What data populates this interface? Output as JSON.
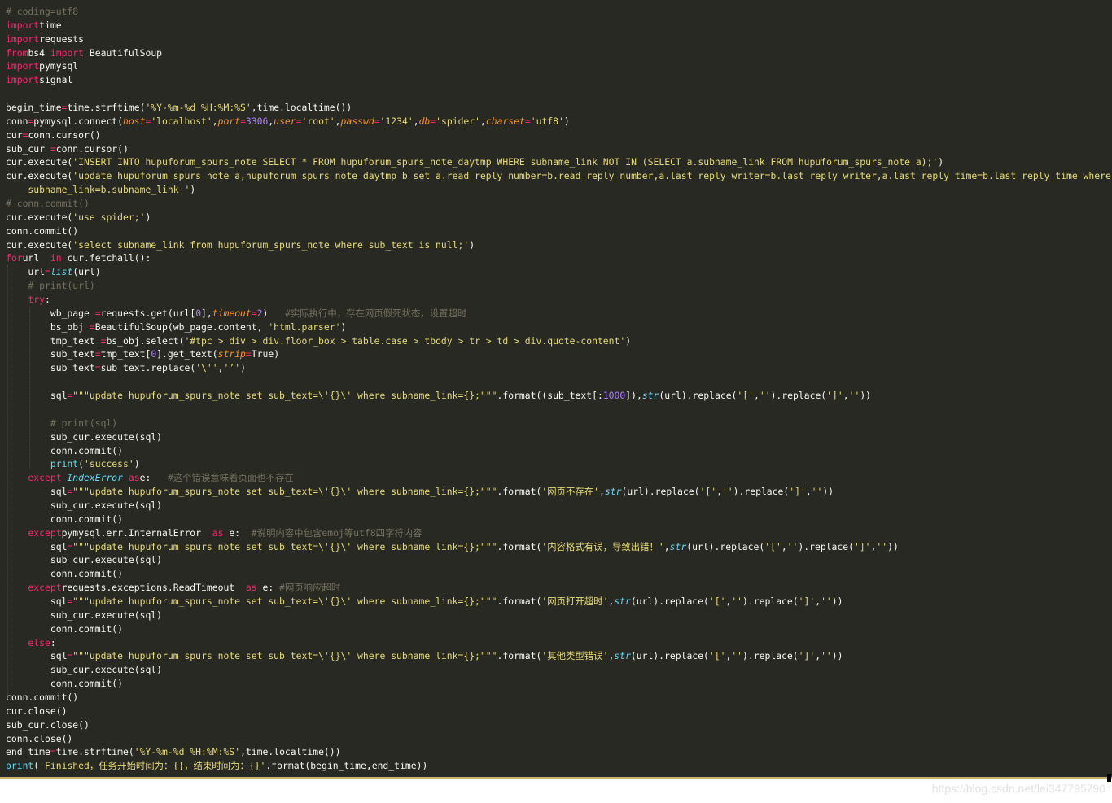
{
  "editor": {
    "theme_colors": {
      "background": "#282923",
      "text": "#f8f8f2",
      "keyword": "#f92672",
      "string": "#e6db74",
      "number": "#ae81ff",
      "comment": "#75715e",
      "parameter": "#fd971f",
      "builtin": "#66d9ef"
    },
    "lines": [
      [
        [
          "cm",
          "# coding=utf8"
        ]
      ],
      [
        [
          "kw",
          "import"
        ],
        [
          "",
          "time"
        ]
      ],
      [
        [
          "kw",
          "import"
        ],
        [
          "",
          "requests"
        ]
      ],
      [
        [
          "kw",
          "from"
        ],
        [
          "",
          "bs4"
        ],
        [
          "kw",
          "import"
        ],
        [
          "",
          "BeautifulSoup"
        ]
      ],
      [
        [
          "kw",
          "import"
        ],
        [
          "",
          "pymysql"
        ]
      ],
      [
        [
          "kw",
          "import"
        ],
        [
          "",
          "signal"
        ]
      ],
      [],
      [
        [
          "",
          "begin_time"
        ],
        [
          "kw",
          "="
        ],
        [
          "",
          "time.strftime("
        ],
        [
          "str",
          "'%Y-%m-%d %H:%M:%S'"
        ],
        [
          "",
          ",time.localtime())"
        ]
      ],
      [
        [
          "",
          "conn"
        ],
        [
          "kw",
          "="
        ],
        [
          "",
          "pymysql.connect("
        ],
        [
          "param",
          "host"
        ],
        [
          "kw",
          "="
        ],
        [
          "str",
          "'localhost'"
        ],
        [
          "",
          ","
        ],
        [
          "param",
          "port"
        ],
        [
          "kw",
          "="
        ],
        [
          "num",
          "3306"
        ],
        [
          "",
          ","
        ],
        [
          "param",
          "user"
        ],
        [
          "kw",
          "="
        ],
        [
          "str",
          "'root'"
        ],
        [
          "",
          ","
        ],
        [
          "param",
          "passwd"
        ],
        [
          "kw",
          "="
        ],
        [
          "str",
          "'1234'"
        ],
        [
          "",
          ","
        ],
        [
          "param",
          "db"
        ],
        [
          "kw",
          "="
        ],
        [
          "str",
          "'spider'"
        ],
        [
          "",
          ","
        ],
        [
          "param",
          "charset"
        ],
        [
          "kw",
          "="
        ],
        [
          "str",
          "'utf8'"
        ],
        [
          "",
          ")"
        ]
      ],
      [
        [
          "",
          "cur"
        ],
        [
          "kw",
          "="
        ],
        [
          "",
          "conn.cursor()"
        ]
      ],
      [
        [
          "",
          "sub_cur "
        ],
        [
          "kw",
          "="
        ],
        [
          "",
          ""
        ],
        [
          "",
          "conn.cursor()"
        ]
      ],
      [
        [
          "",
          "cur.execute("
        ],
        [
          "str",
          "'INSERT INTO hupuforum_spurs_note SELECT * FROM hupuforum_spurs_note_daytmp WHERE subname_link NOT IN (SELECT a.subname_link FROM hupuforum_spurs_note a);'"
        ],
        [
          "",
          ")"
        ]
      ],
      [
        [
          "",
          "cur.execute("
        ],
        [
          "str",
          "'update hupuforum_spurs_note a,hupuforum_spurs_note_daytmp b set a.read_reply_number=b.read_reply_number,a.last_reply_writer=b.last_reply_writer,a.last_reply_time=b.last_reply_time where a."
        ]
      ],
      [
        [
          "str",
          "    subname_link=b.subname_link '"
        ],
        [
          "",
          ")"
        ]
      ],
      [
        [
          "cm",
          "# conn.commit()"
        ]
      ],
      [
        [
          "",
          "cur.execute("
        ],
        [
          "str",
          "'use spider;'"
        ],
        [
          "",
          ")"
        ]
      ],
      [
        [
          "",
          "conn.commit()"
        ]
      ],
      [
        [
          "",
          "cur.execute("
        ],
        [
          "str",
          "'select subname_link from hupuforum_spurs_note where sub_text is null;'"
        ],
        [
          "",
          ")"
        ]
      ],
      [
        [
          "kw",
          "for"
        ],
        [
          "",
          "url "
        ],
        [
          "kw",
          "in"
        ],
        [
          "",
          "cur.fetchall():"
        ]
      ],
      [
        [
          "",
          "    url"
        ],
        [
          "kw",
          "="
        ],
        [
          "bi",
          "list"
        ],
        [
          "",
          "(url)"
        ]
      ],
      [
        [
          "cm",
          "    # print(url)"
        ]
      ],
      [
        [
          "kw",
          "    try"
        ],
        [
          "",
          ":"
        ]
      ],
      [
        [
          "",
          "        wb_page "
        ],
        [
          "kw",
          "="
        ],
        [
          "",
          "requests.get(url["
        ],
        [
          "num",
          "0"
        ],
        [
          "",
          "],"
        ],
        [
          "param",
          "timeout"
        ],
        [
          "kw",
          "="
        ],
        [
          "num",
          "2"
        ],
        [
          "",
          ")   "
        ],
        [
          "cm",
          "#实际执行中，存在网页假死状态，设置超时"
        ]
      ],
      [
        [
          "",
          "        bs_obj "
        ],
        [
          "kw",
          "="
        ],
        [
          "",
          "BeautifulSoup(wb_page.content, "
        ],
        [
          "str",
          "'html.parser'"
        ],
        [
          "",
          ")"
        ]
      ],
      [
        [
          "",
          "        tmp_text "
        ],
        [
          "kw",
          "="
        ],
        [
          "",
          "bs_obj.select("
        ],
        [
          "str",
          "'#tpc > div > div.floor_box > table.case > tbody > tr > td > div.quote-content'"
        ],
        [
          "",
          ")"
        ]
      ],
      [
        [
          "",
          "        sub_text"
        ],
        [
          "kw",
          "="
        ],
        [
          "",
          "tmp_text["
        ],
        [
          "num",
          "0"
        ],
        [
          "",
          "].get_text("
        ],
        [
          "param",
          "strip"
        ],
        [
          "kw",
          "="
        ],
        [
          "",
          "True)"
        ]
      ],
      [
        [
          "",
          "        sub_text"
        ],
        [
          "kw",
          "="
        ],
        [
          "",
          "sub_text.replace("
        ],
        [
          "str",
          "'\\''"
        ],
        [
          "",
          ","
        ],
        [
          "str",
          "'’'"
        ],
        [
          "",
          ")"
        ]
      ],
      [],
      [
        [
          "",
          "        sql"
        ],
        [
          "kw",
          "="
        ],
        [
          "str",
          "\"\"\"update hupuforum_spurs_note set sub_text=\\'{}\\' where subname_link={};\"\"\""
        ],
        [
          "",
          ".format((sub_text[:"
        ],
        [
          "num",
          "1000"
        ],
        [
          "",
          "]),"
        ],
        [
          "bi",
          "str"
        ],
        [
          "",
          "(url).replace("
        ],
        [
          "str",
          "'['"
        ],
        [
          "",
          ","
        ],
        [
          "str",
          "''"
        ],
        [
          "",
          ").replace("
        ],
        [
          "str",
          "']'"
        ],
        [
          "",
          ","
        ],
        [
          "str",
          "''"
        ],
        [
          "",
          "))"
        ]
      ],
      [],
      [
        [
          "cm",
          "        # print(sql)"
        ]
      ],
      [
        [
          "",
          "        sub_cur.execute(sql)"
        ]
      ],
      [
        [
          "",
          "        conn.commit()"
        ]
      ],
      [
        [
          "fn",
          "        print"
        ],
        [
          "",
          "("
        ],
        [
          "str",
          "'success'"
        ],
        [
          "",
          ")"
        ]
      ],
      [
        [
          "kw",
          "    except"
        ],
        [
          "",
          ""
        ],
        [
          "bi",
          " IndexError"
        ],
        [
          "kw",
          " as"
        ],
        [
          "",
          "e:   "
        ],
        [
          "cm",
          "#这个错误意味着页面也不存在"
        ]
      ],
      [
        [
          "",
          "        sql"
        ],
        [
          "kw",
          "="
        ],
        [
          "str",
          "\"\"\"update hupuforum_spurs_note set sub_text=\\'{}\\' where subname_link={};\"\"\""
        ],
        [
          "",
          ".format("
        ],
        [
          "str",
          "'网页不存在'"
        ],
        [
          "",
          ","
        ],
        [
          "bi",
          "str"
        ],
        [
          "",
          "(url).replace("
        ],
        [
          "str",
          "'['"
        ],
        [
          "",
          ","
        ],
        [
          "str",
          "''"
        ],
        [
          "",
          ").replace("
        ],
        [
          "str",
          "']'"
        ],
        [
          "",
          ","
        ],
        [
          "str",
          "''"
        ],
        [
          "",
          "))"
        ]
      ],
      [
        [
          "",
          "        sub_cur.execute(sql)"
        ]
      ],
      [
        [
          "",
          "        conn.commit()"
        ]
      ],
      [
        [
          "kw",
          "    except"
        ],
        [
          "",
          "pymysql.err.InternalError "
        ],
        [
          "kw",
          "as"
        ],
        [
          "",
          "e:  "
        ],
        [
          "cm",
          "#说明内容中包含emoj等utf8四字符内容"
        ]
      ],
      [
        [
          "",
          "        sql"
        ],
        [
          "kw",
          "="
        ],
        [
          "str",
          "\"\"\"update hupuforum_spurs_note set sub_text=\\'{}\\' where subname_link={};\"\"\""
        ],
        [
          "",
          ".format("
        ],
        [
          "str",
          "'内容格式有误，导致出错！'"
        ],
        [
          "",
          ","
        ],
        [
          "bi",
          "str"
        ],
        [
          "",
          "(url).replace("
        ],
        [
          "str",
          "'['"
        ],
        [
          "",
          ","
        ],
        [
          "str",
          "''"
        ],
        [
          "",
          ").replace("
        ],
        [
          "str",
          "']'"
        ],
        [
          "",
          ","
        ],
        [
          "str",
          "''"
        ],
        [
          "",
          "))"
        ]
      ],
      [
        [
          "",
          "        sub_cur.execute(sql)"
        ]
      ],
      [
        [
          "",
          "        conn.commit()"
        ]
      ],
      [
        [
          "kw",
          "    except"
        ],
        [
          "",
          "requests.exceptions.ReadTimeout "
        ],
        [
          "kw",
          "as"
        ],
        [
          "",
          "e: "
        ],
        [
          "cm",
          "#网页响应超时"
        ]
      ],
      [
        [
          "",
          "        sql"
        ],
        [
          "kw",
          "="
        ],
        [
          "str",
          "\"\"\"update hupuforum_spurs_note set sub_text=\\'{}\\' where subname_link={};\"\"\""
        ],
        [
          "",
          ".format("
        ],
        [
          "str",
          "'网页打开超时'"
        ],
        [
          "",
          ","
        ],
        [
          "bi",
          "str"
        ],
        [
          "",
          "(url).replace("
        ],
        [
          "str",
          "'['"
        ],
        [
          "",
          ","
        ],
        [
          "str",
          "''"
        ],
        [
          "",
          ").replace("
        ],
        [
          "str",
          "']'"
        ],
        [
          "",
          ","
        ],
        [
          "str",
          "''"
        ],
        [
          "",
          "))"
        ]
      ],
      [
        [
          "",
          "        sub_cur.execute(sql)"
        ]
      ],
      [
        [
          "",
          "        conn.commit()"
        ]
      ],
      [
        [
          "kw",
          "    else"
        ],
        [
          "",
          ":"
        ]
      ],
      [
        [
          "",
          "        sql"
        ],
        [
          "kw",
          "="
        ],
        [
          "str",
          "\"\"\"update hupuforum_spurs_note set sub_text=\\'{}\\' where subname_link={};\"\"\""
        ],
        [
          "",
          ".format("
        ],
        [
          "str",
          "'其他类型错误'"
        ],
        [
          "",
          ","
        ],
        [
          "bi",
          "str"
        ],
        [
          "",
          "(url).replace("
        ],
        [
          "str",
          "'['"
        ],
        [
          "",
          ","
        ],
        [
          "str",
          "''"
        ],
        [
          "",
          ").replace("
        ],
        [
          "str",
          "']'"
        ],
        [
          "",
          ","
        ],
        [
          "str",
          "''"
        ],
        [
          "",
          "))"
        ]
      ],
      [
        [
          "",
          "        sub_cur.execute(sql)"
        ]
      ],
      [
        [
          "",
          "        conn.commit()"
        ]
      ],
      [
        [
          "",
          "conn.commit()"
        ]
      ],
      [
        [
          "",
          "cur.close()"
        ]
      ],
      [
        [
          "",
          "sub_cur.close()"
        ]
      ],
      [
        [
          "",
          "conn.close()"
        ]
      ],
      [
        [
          "",
          "end_time"
        ],
        [
          "kw",
          "="
        ],
        [
          "",
          "time.strftime("
        ],
        [
          "str",
          "'%Y-%m-%d %H:%M:%S'"
        ],
        [
          "",
          ",time.localtime())"
        ]
      ],
      [
        [
          "fn",
          "print"
        ],
        [
          "",
          "("
        ],
        [
          "str",
          "'Finished，任务开始时间为：{}，结束时间为：{}'"
        ],
        [
          "",
          ".format(begin_time,end_time))"
        ]
      ]
    ]
  },
  "watermark": "https://blog.csdn.net/lei347795790"
}
